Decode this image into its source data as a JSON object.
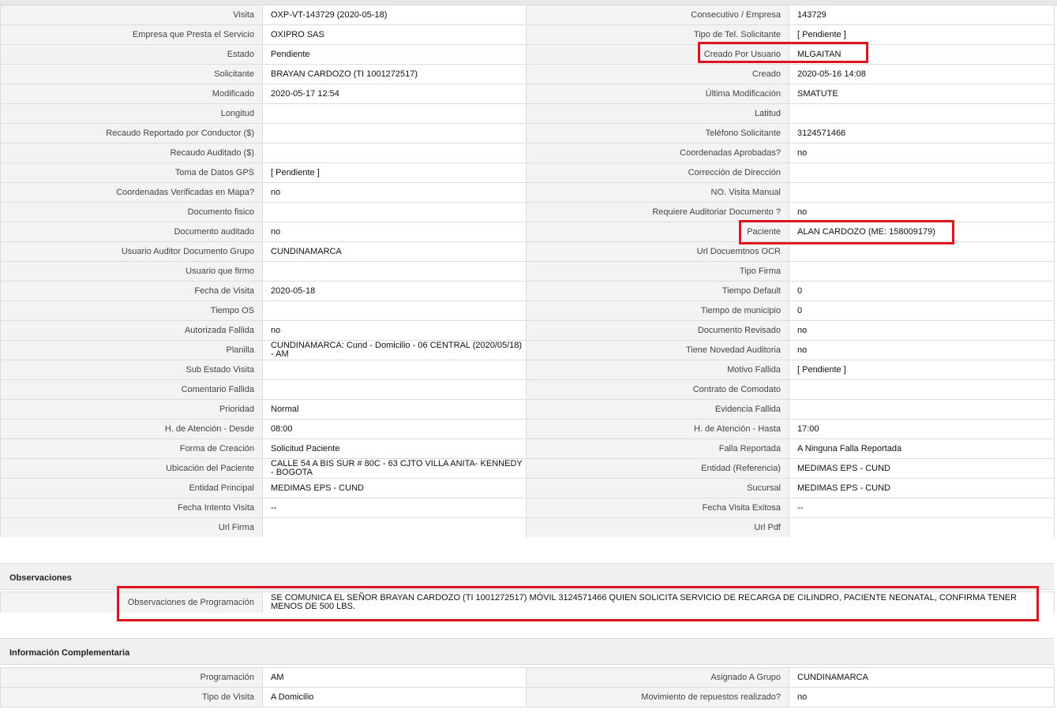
{
  "colors": {
    "label_bg": "#f3f3f3",
    "value_bg": "#ffffff",
    "border": "#dcdcdc",
    "highlight": "#e0141e",
    "section_bg": "#f0f0f0"
  },
  "rows": [
    {
      "l1": "Visita",
      "v1": "OXP-VT-143729 (2020-05-18)",
      "l2": "Consecutivo / Empresa",
      "v2": "143729"
    },
    {
      "l1": "Empresa que Presta el Servicio",
      "v1": "OXIPRO SAS",
      "l2": "Tipo de Tel. Solicitante",
      "v2": "[ Pendiente ]"
    },
    {
      "l1": "Estado",
      "v1": "Pendiente",
      "l2": "Creado Por Usuario",
      "v2": "MLGAITAN"
    },
    {
      "l1": "Solicitante",
      "v1": "BRAYAN CARDOZO (TI 1001272517)",
      "l2": "Creado",
      "v2": "2020-05-16 14:08"
    },
    {
      "l1": "Modificado",
      "v1": "2020-05-17 12:54",
      "l2": "Última Modificación",
      "v2": " SMATUTE"
    },
    {
      "l1": "Longitud",
      "v1": "",
      "l2": "Latitud",
      "v2": ""
    },
    {
      "l1": "Recaudo Reportado por Conductor ($)",
      "v1": "",
      "l2": "Teléfono Solicitante",
      "v2": "3124571466"
    },
    {
      "l1": "Recaudo Auditado ($)",
      "v1": "",
      "l2": "Coordenadas Aprobadas?",
      "v2": " no"
    },
    {
      "l1": "Toma de Datos GPS",
      "v1": "[ Pendiente ]",
      "l2": "Corrección de Dirección",
      "v2": ""
    },
    {
      "l1": "Coordenadas Verificadas en Mapa?",
      "v1": " no",
      "l2": "NO. Visita Manual",
      "v2": ""
    },
    {
      "l1": "Documento fisico",
      "v1": "",
      "l2": "Requiere Auditoriar Documento ?",
      "v2": " no"
    },
    {
      "l1": "Documento auditado",
      "v1": " no",
      "l2": "Paciente",
      "v2": "ALAN CARDOZO (ME: 158009179)"
    },
    {
      "l1": "Usuario Auditor Documento Grupo",
      "v1": "CUNDINAMARCA",
      "l2": "Url Docuemtnos OCR",
      "v2": ""
    },
    {
      "l1": "Usuario que firmo",
      "v1": "",
      "l2": "Tipo Firma",
      "v2": ""
    },
    {
      "l1": "Fecha de Visita",
      "v1": " 2020-05-18",
      "l2": "Tiempo Default",
      "v2": "0"
    },
    {
      "l1": "Tiempo OS",
      "v1": "",
      "l2": "Tiempo de municipio",
      "v2": "0"
    },
    {
      "l1": "Autorizada Fallida",
      "v1": " no",
      "l2": "Documento Revisado",
      "v2": " no"
    },
    {
      "l1": "Planilla",
      "v1": "CUNDINAMARCA: Cund - Domicilio - 06 CENTRAL (2020/05/18) - AM",
      "l2": "Tiene Novedad Auditoria",
      "v2": " no"
    },
    {
      "l1": "Sub Estado Visita",
      "v1": "",
      "l2": "Motivo Fallida",
      "v2": "[ Pendiente ]"
    },
    {
      "l1": "Comentario Fallida",
      "v1": "",
      "l2": "Contrato de Comodato",
      "v2": ""
    },
    {
      "l1": "Prioridad",
      "v1": "Normal",
      "l2": "Evidencia Fallida",
      "v2": ""
    },
    {
      "l1": "H. de Atención - Desde",
      "v1": "08:00",
      "l2": "H. de Atención - Hasta",
      "v2": "17:00"
    },
    {
      "l1": "Forma de Creación",
      "v1": "Solicitud Paciente",
      "l2": "Falla Reportada",
      "v2": "A Ninguna Falla Reportada"
    },
    {
      "l1": "Ubicación del Paciente",
      "v1": "CALLE 54 A BIS SUR # 80C - 63 CJTO VILLA ANITA- KENNEDY - BOGOTA",
      "l2": "Entidad (Referencia)",
      "v2": "MEDIMAS EPS - CUND"
    },
    {
      "l1": "Entidad Principal",
      "v1": "MEDIMAS EPS - CUND",
      "l2": "Sucursal",
      "v2": "MEDIMAS EPS - CUND"
    },
    {
      "l1": "Fecha Intento Visita",
      "v1": " --",
      "l2": "Fecha Visita Exitosa",
      "v2": " --"
    },
    {
      "l1": "Url Firma",
      "v1": "",
      "l2": "Url Pdf",
      "v2": ""
    }
  ],
  "observaciones": {
    "section_title": "Observaciones",
    "label": "Observaciones de Programación",
    "value": "  SE COMUNICA EL SEÑOR BRAYAN CARDOZO (TI 1001272517) MÓVIL 3124571466 QUIEN SOLICITA SERVICIO DE RECARGA DE CILINDRO, PACIENTE NEONATAL, CONFIRMA TENER MENOS DE 500 LBS."
  },
  "info": {
    "section_title": "Información Complementaria",
    "rows": [
      {
        "l1": "Programación",
        "v1": "AM",
        "l2": "Asignado A Grupo",
        "v2": "CUNDINAMARCA"
      },
      {
        "l1": "Tipo de Visita",
        "v1": "A Domicilio",
        "l2": "Movimiento de repuestos realizado?",
        "v2": " no"
      }
    ]
  }
}
